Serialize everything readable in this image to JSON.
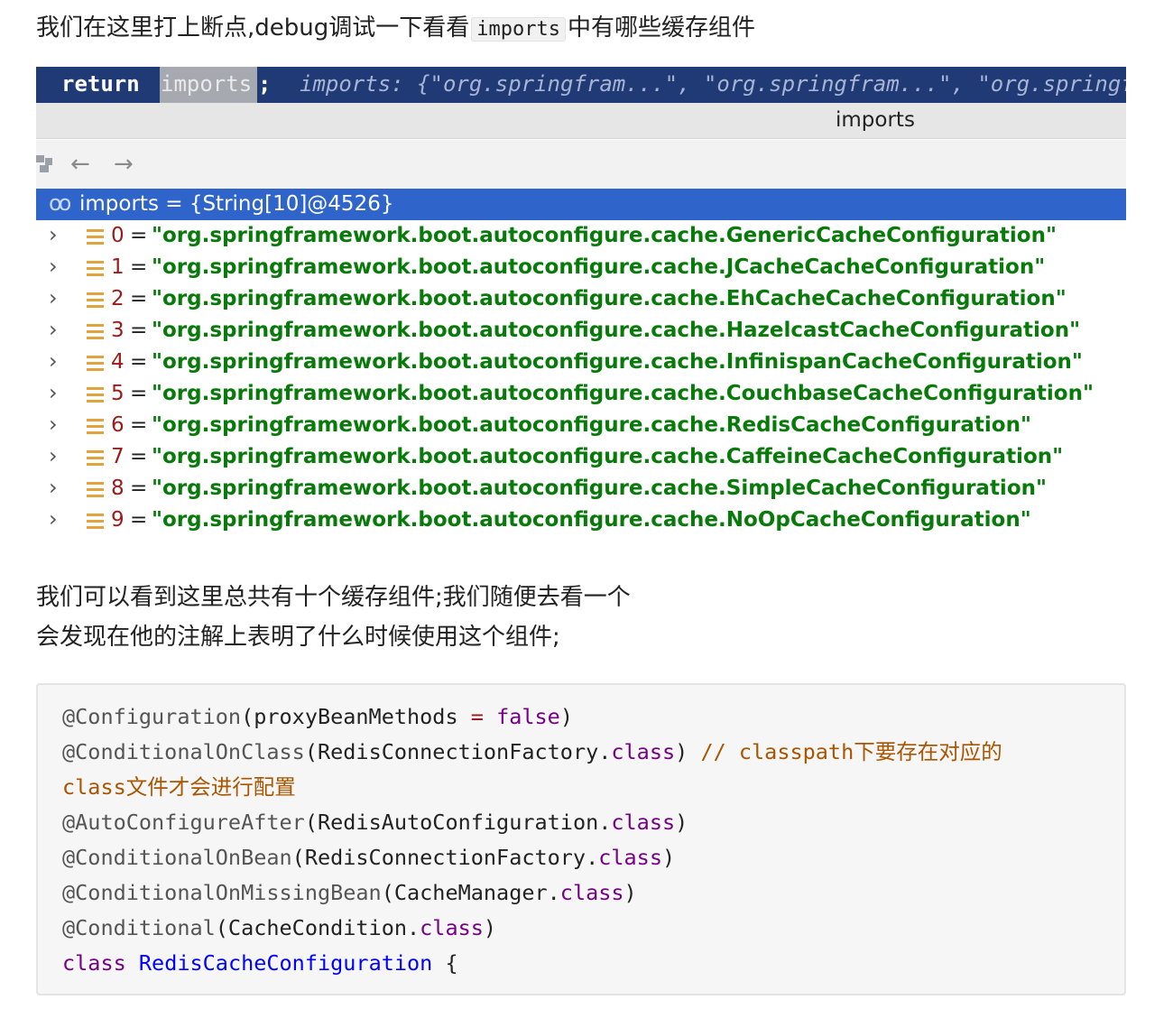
{
  "intro": {
    "before": "我们在这里打上断点,debug调试一下看看",
    "code": "imports",
    "after": "中有哪些缓存组件"
  },
  "debugger": {
    "code_line": {
      "keyword": "return",
      "variable": "imports",
      "semicolon": ";",
      "hint": "imports: {\"org.springfram...\", \"org.springfram...\", \"org.springfram...\""
    },
    "panel_title": "imports",
    "toolbar": {
      "back_icon": "arrow-left-icon",
      "forward_icon": "arrow-right-icon"
    },
    "selected": "imports = {String[10]@4526}",
    "items": [
      {
        "index": "0",
        "value": "\"org.springframework.boot.autoconfigure.cache.GenericCacheConfiguration\""
      },
      {
        "index": "1",
        "value": "\"org.springframework.boot.autoconfigure.cache.JCacheCacheConfiguration\""
      },
      {
        "index": "2",
        "value": "\"org.springframework.boot.autoconfigure.cache.EhCacheCacheConfiguration\""
      },
      {
        "index": "3",
        "value": "\"org.springframework.boot.autoconfigure.cache.HazelcastCacheConfiguration\""
      },
      {
        "index": "4",
        "value": "\"org.springframework.boot.autoconfigure.cache.InfinispanCacheConfiguration\""
      },
      {
        "index": "5",
        "value": "\"org.springframework.boot.autoconfigure.cache.CouchbaseCacheConfiguration\""
      },
      {
        "index": "6",
        "value": "\"org.springframework.boot.autoconfigure.cache.RedisCacheConfiguration\""
      },
      {
        "index": "7",
        "value": "\"org.springframework.boot.autoconfigure.cache.CaffeineCacheConfiguration\""
      },
      {
        "index": "8",
        "value": "\"org.springframework.boot.autoconfigure.cache.SimpleCacheConfiguration\""
      },
      {
        "index": "9",
        "value": "\"org.springframework.boot.autoconfigure.cache.NoOpCacheConfiguration\""
      }
    ],
    "colors": {
      "code_bg": "#203a76",
      "selection_bg": "#2f65ca",
      "string_value": "#077a0a",
      "index": "#9a1b1b"
    }
  },
  "explanation": {
    "line1": "我们可以看到这里总共有十个缓存组件;我们随便去看一个",
    "line2": "会发现在他的注解上表明了什么时候使用这个组件;"
  },
  "code_block": {
    "l1": {
      "ann": "@Configuration",
      "p1": "(proxyBeanMethods ",
      "eq": "=",
      "sp": " ",
      "kw": "false",
      "p2": ")"
    },
    "l2": {
      "ann": "@ConditionalOnClass",
      "p1": "(RedisConnectionFactory.",
      "kw": "class",
      "p2": ") ",
      "comment": "// classpath下要存在对应的"
    },
    "l3": {
      "comment": "class文件才会进行配置"
    },
    "l4": {
      "ann": "@AutoConfigureAfter",
      "p1": "(RedisAutoConfiguration.",
      "kw": "class",
      "p2": ")"
    },
    "l5": {
      "ann": "@ConditionalOnBean",
      "p1": "(RedisConnectionFactory.",
      "kw": "class",
      "p2": ")"
    },
    "l6": {
      "ann": "@ConditionalOnMissingBean",
      "p1": "(CacheManager.",
      "kw": "class",
      "p2": ")"
    },
    "l7": {
      "ann": "@Conditional",
      "p1": "(CacheCondition.",
      "kw": "class",
      "p2": ")"
    },
    "l8": {
      "kw": "class",
      "sp": " ",
      "def": "RedisCacheConfiguration",
      "p2": " {"
    }
  }
}
